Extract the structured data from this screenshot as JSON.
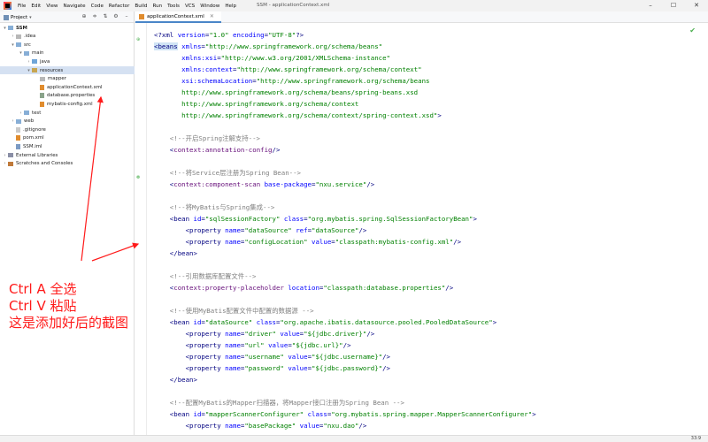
{
  "menu": [
    "File",
    "Edit",
    "View",
    "Navigate",
    "Code",
    "Refactor",
    "Build",
    "Run",
    "Tools",
    "VCS",
    "Window",
    "Help"
  ],
  "window_title": "SSM - applicationContext.xml",
  "window_controls": [
    "–",
    "☐",
    "✕"
  ],
  "project_panel": {
    "label": "Project",
    "caret": "▾",
    "tools": [
      "⊕",
      "≑",
      "⇅",
      "⚙",
      "–"
    ]
  },
  "tab": {
    "label": "applicationContext.xml",
    "close": "✕"
  },
  "tree": [
    {
      "label": "SSM",
      "arrow": "▾",
      "icon": "folder",
      "indent": 0,
      "bold": true
    },
    {
      "label": ".idea",
      "arrow": "›",
      "icon": "folder-gray",
      "indent": 1
    },
    {
      "label": "src",
      "arrow": "▾",
      "icon": "folder",
      "indent": 1
    },
    {
      "label": "main",
      "arrow": "▾",
      "icon": "folder",
      "indent": 2
    },
    {
      "label": "java",
      "arrow": "›",
      "icon": "folder-src",
      "indent": 3
    },
    {
      "label": "resources",
      "arrow": "▾",
      "icon": "folder-res",
      "indent": 3,
      "selected": true
    },
    {
      "label": "mapper",
      "arrow": "",
      "icon": "folder-gray",
      "indent": 4
    },
    {
      "label": "applicationContext.xml",
      "arrow": "",
      "icon": "xml",
      "indent": 4
    },
    {
      "label": "database.properties",
      "arrow": "",
      "icon": "props",
      "indent": 4
    },
    {
      "label": "mybatis-config.xml",
      "arrow": "",
      "icon": "xml",
      "indent": 4
    },
    {
      "label": "test",
      "arrow": "›",
      "icon": "folder",
      "indent": 2
    },
    {
      "label": "web",
      "arrow": "›",
      "icon": "folder",
      "indent": 1
    },
    {
      "label": ".gitignore",
      "arrow": "",
      "icon": "file",
      "indent": 1
    },
    {
      "label": "pom.xml",
      "arrow": "",
      "icon": "xml",
      "indent": 1
    },
    {
      "label": "SSM.iml",
      "arrow": "",
      "icon": "iml",
      "indent": 1
    },
    {
      "label": "External Libraries",
      "arrow": "›",
      "icon": "lib",
      "indent": 0
    },
    {
      "label": "Scratches and Consoles",
      "arrow": "›",
      "icon": "scratch",
      "indent": 0
    }
  ],
  "annotation": [
    "Ctrl A 全选",
    "Ctrl V 粘贴",
    "这是添加好后的截图"
  ],
  "code": [
    [
      [
        "tag",
        "<?xml "
      ],
      [
        "attr",
        "version"
      ],
      [
        "tag",
        "="
      ],
      [
        "val",
        "\"1.0\""
      ],
      [
        "tag",
        " "
      ],
      [
        "attr",
        "encoding"
      ],
      [
        "tag",
        "="
      ],
      [
        "val",
        "\"UTF-8\""
      ],
      [
        "tag",
        "?>"
      ]
    ],
    [
      [
        "hl",
        "<beans"
      ],
      [
        "tag",
        " "
      ],
      [
        "attr",
        "xmlns"
      ],
      [
        "tag",
        "="
      ],
      [
        "val",
        "\"http://www.springframework.org/schema/beans\""
      ]
    ],
    [
      [
        "tag",
        "       "
      ],
      [
        "attr",
        "xmlns:xsi"
      ],
      [
        "tag",
        "="
      ],
      [
        "val",
        "\"http://www.w3.org/2001/XMLSchema-instance\""
      ]
    ],
    [
      [
        "tag",
        "       "
      ],
      [
        "attr",
        "xmlns:context"
      ],
      [
        "tag",
        "="
      ],
      [
        "val",
        "\"http://www.springframework.org/schema/context\""
      ]
    ],
    [
      [
        "tag",
        "       "
      ],
      [
        "attr",
        "xsi:schemaLocation"
      ],
      [
        "tag",
        "="
      ],
      [
        "val",
        "\"http://www.springframework.org/schema/beans"
      ]
    ],
    [
      [
        "val",
        "       http://www.springframework.org/schema/beans/spring-beans.xsd"
      ]
    ],
    [
      [
        "val",
        "       http://www.springframework.org/schema/context"
      ]
    ],
    [
      [
        "val",
        "       http://www.springframework.org/schema/context/spring-context.xsd\""
      ],
      [
        "tag",
        ">"
      ]
    ],
    [],
    [
      [
        "cmt",
        "    <!--开启Spring注解支持-->"
      ]
    ],
    [
      [
        "tag",
        "    <"
      ],
      [
        "ns",
        "context:annotation-config"
      ],
      [
        "tag",
        "/>"
      ]
    ],
    [],
    [
      [
        "cmt",
        "    <!--将Service层注册为Spring Bean-->"
      ]
    ],
    [
      [
        "tag",
        "    <"
      ],
      [
        "ns",
        "context:component-scan"
      ],
      [
        "tag",
        " "
      ],
      [
        "attr",
        "base-package"
      ],
      [
        "tag",
        "="
      ],
      [
        "val",
        "\"nxu.service\""
      ],
      [
        "tag",
        "/>"
      ]
    ],
    [],
    [
      [
        "cmt",
        "    <!--将MyBatis与Spring集成-->"
      ]
    ],
    [
      [
        "tag",
        "    <bean "
      ],
      [
        "attr",
        "id"
      ],
      [
        "tag",
        "="
      ],
      [
        "val",
        "\"sqlSessionFactory\""
      ],
      [
        "tag",
        " "
      ],
      [
        "attr",
        "class"
      ],
      [
        "tag",
        "="
      ],
      [
        "val",
        "\"org.mybatis.spring.SqlSessionFactoryBean\""
      ],
      [
        "tag",
        ">"
      ]
    ],
    [
      [
        "tag",
        "        <property "
      ],
      [
        "attr",
        "name"
      ],
      [
        "tag",
        "="
      ],
      [
        "val",
        "\"dataSource\""
      ],
      [
        "tag",
        " "
      ],
      [
        "attr",
        "ref"
      ],
      [
        "tag",
        "="
      ],
      [
        "val",
        "\"dataSource\""
      ],
      [
        "tag",
        "/>"
      ]
    ],
    [
      [
        "tag",
        "        <property "
      ],
      [
        "attr",
        "name"
      ],
      [
        "tag",
        "="
      ],
      [
        "val",
        "\"configLocation\""
      ],
      [
        "tag",
        " "
      ],
      [
        "attr",
        "value"
      ],
      [
        "tag",
        "="
      ],
      [
        "val",
        "\"classpath:mybatis-config.xml\""
      ],
      [
        "tag",
        "/>"
      ]
    ],
    [
      [
        "tag",
        "    </bean>"
      ]
    ],
    [],
    [
      [
        "cmt",
        "    <!--引用数据库配置文件-->"
      ]
    ],
    [
      [
        "tag",
        "    <"
      ],
      [
        "ns",
        "context:property-placeholder"
      ],
      [
        "tag",
        " "
      ],
      [
        "attr",
        "location"
      ],
      [
        "tag",
        "="
      ],
      [
        "val",
        "\"classpath:database.properties\""
      ],
      [
        "tag",
        "/>"
      ]
    ],
    [],
    [
      [
        "cmt",
        "    <!--使用MyBatis配置文件中配置的数据源 -->"
      ]
    ],
    [
      [
        "tag",
        "    <bean "
      ],
      [
        "attr",
        "id"
      ],
      [
        "tag",
        "="
      ],
      [
        "val",
        "\"dataSource\""
      ],
      [
        "tag",
        " "
      ],
      [
        "attr",
        "class"
      ],
      [
        "tag",
        "="
      ],
      [
        "val",
        "\"org.apache.ibatis.datasource.pooled.PooledDataSource\""
      ],
      [
        "tag",
        ">"
      ]
    ],
    [
      [
        "tag",
        "        <property "
      ],
      [
        "attr",
        "name"
      ],
      [
        "tag",
        "="
      ],
      [
        "val",
        "\"driver\""
      ],
      [
        "tag",
        " "
      ],
      [
        "attr",
        "value"
      ],
      [
        "tag",
        "="
      ],
      [
        "val",
        "\"${jdbc.driver}\""
      ],
      [
        "tag",
        "/>"
      ]
    ],
    [
      [
        "tag",
        "        <property "
      ],
      [
        "attr",
        "name"
      ],
      [
        "tag",
        "="
      ],
      [
        "val",
        "\"url\""
      ],
      [
        "tag",
        " "
      ],
      [
        "attr",
        "value"
      ],
      [
        "tag",
        "="
      ],
      [
        "val",
        "\"${jdbc.url}\""
      ],
      [
        "tag",
        "/>"
      ]
    ],
    [
      [
        "tag",
        "        <property "
      ],
      [
        "attr",
        "name"
      ],
      [
        "tag",
        "="
      ],
      [
        "val",
        "\"username\""
      ],
      [
        "tag",
        " "
      ],
      [
        "attr",
        "value"
      ],
      [
        "tag",
        "="
      ],
      [
        "val",
        "\"${jdbc.username}\""
      ],
      [
        "tag",
        "/>"
      ]
    ],
    [
      [
        "tag",
        "        <property "
      ],
      [
        "attr",
        "name"
      ],
      [
        "tag",
        "="
      ],
      [
        "val",
        "\"password\""
      ],
      [
        "tag",
        " "
      ],
      [
        "attr",
        "value"
      ],
      [
        "tag",
        "="
      ],
      [
        "val",
        "\"${jdbc.password}\""
      ],
      [
        "tag",
        "/>"
      ]
    ],
    [
      [
        "tag",
        "    </bean>"
      ]
    ],
    [],
    [
      [
        "cmt",
        "    <!--配置MyBatis的Mapper扫描器，将Mapper接口注册为Spring Bean -->"
      ]
    ],
    [
      [
        "tag",
        "    <bean "
      ],
      [
        "attr",
        "id"
      ],
      [
        "tag",
        "="
      ],
      [
        "val",
        "\"mapperScannerConfigurer\""
      ],
      [
        "tag",
        " "
      ],
      [
        "attr",
        "class"
      ],
      [
        "tag",
        "="
      ],
      [
        "val",
        "\"org.mybatis.spring.mapper.MapperScannerConfigurer\""
      ],
      [
        "tag",
        ">"
      ]
    ],
    [
      [
        "tag",
        "        <property "
      ],
      [
        "attr",
        "name"
      ],
      [
        "tag",
        "="
      ],
      [
        "val",
        "\"basePackage\""
      ],
      [
        "tag",
        " "
      ],
      [
        "attr",
        "value"
      ],
      [
        "tag",
        "="
      ],
      [
        "val",
        "\"nxu.dao\""
      ],
      [
        "tag",
        "/>"
      ]
    ]
  ],
  "status": {
    "position": "33:9"
  },
  "colors": {
    "annotation": "#ff1a1a",
    "selection": "#d5e1f2",
    "tag": "#000080",
    "attr": "#0000ff",
    "value": "#008000",
    "comment": "#808080"
  }
}
